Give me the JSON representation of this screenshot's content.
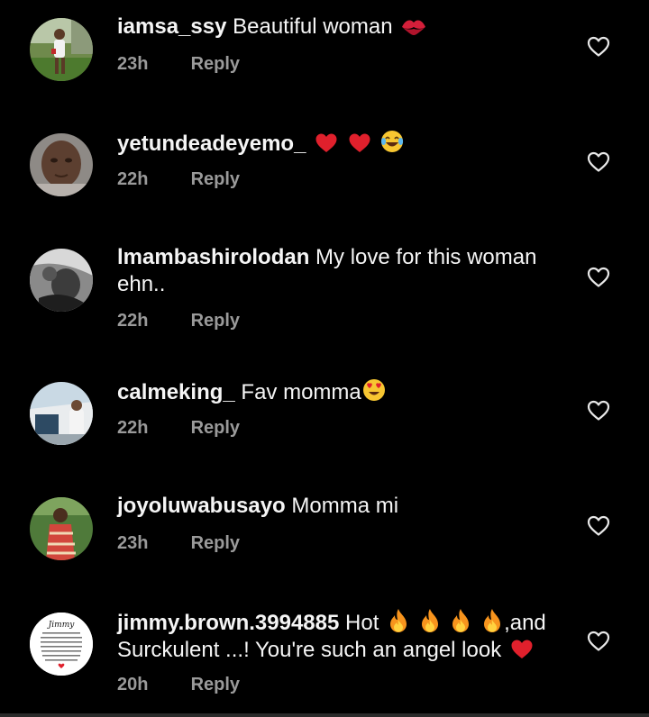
{
  "comments": [
    {
      "username": "iamsa_ssy",
      "text": "Beautiful woman",
      "emojis": [
        "kiss-mark"
      ],
      "time": "23h",
      "reply": "Reply"
    },
    {
      "username": "yetundeadeyemo_",
      "text": "",
      "emojis": [
        "red-heart",
        "red-heart",
        "tears-of-joy"
      ],
      "time": "22h",
      "reply": "Reply"
    },
    {
      "username": "lmambashirolodan",
      "text": "My love for this woman ehn..",
      "emojis": [],
      "time": "22h",
      "reply": "Reply"
    },
    {
      "username": "calmeking_",
      "text": "Fav momma",
      "emojis": [
        "heart-eyes"
      ],
      "time": "22h",
      "reply": "Reply"
    },
    {
      "username": "joyoluwabusayo",
      "text": "Momma mi",
      "emojis": [],
      "time": "23h",
      "reply": "Reply"
    },
    {
      "username": "jimmy.brown.3994885",
      "text_part1": "Hot",
      "text_part2": ",and Surckulent ...! You're such an angel look",
      "emojis": [
        "fire",
        "fire",
        "fire",
        "fire",
        "red-heart"
      ],
      "time": "20h",
      "reply": "Reply",
      "avatar_title": "Jimmy"
    }
  ],
  "colors": {
    "background": "#000000",
    "text": "#f5f5f5",
    "meta": "#9a9a9a",
    "heart_emoji": "#e0202c",
    "like_icon": "#e8e8e8"
  }
}
